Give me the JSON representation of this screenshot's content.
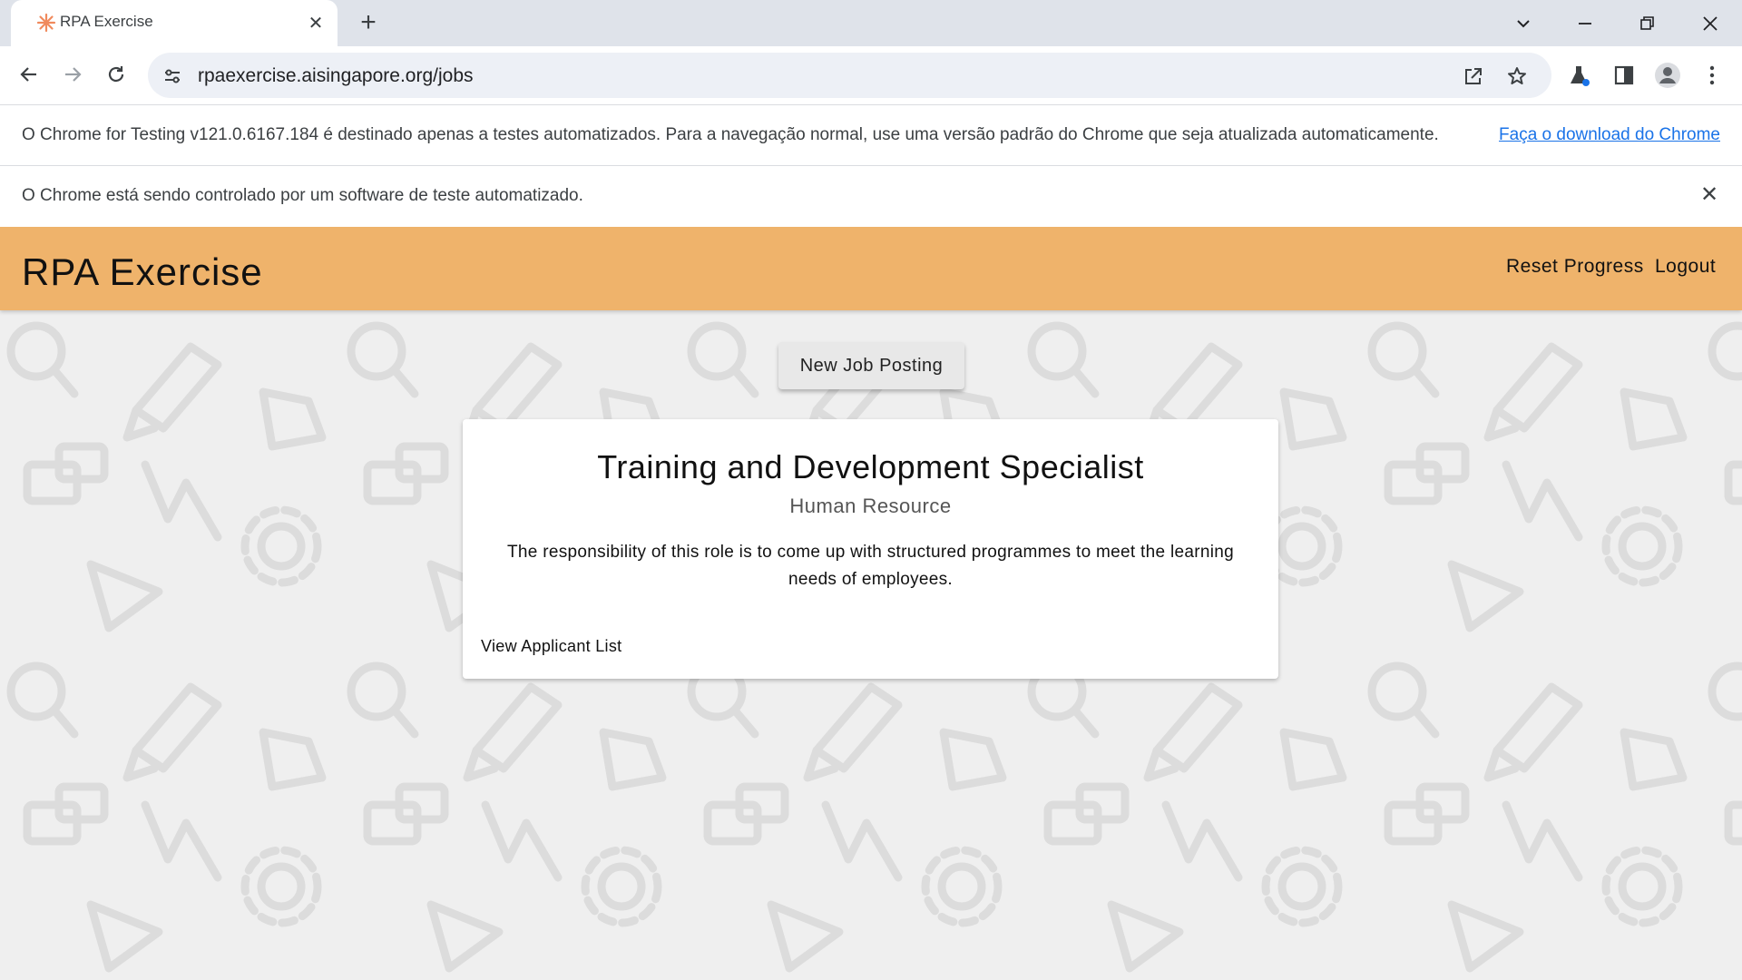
{
  "browser": {
    "tab": {
      "title": "RPA Exercise"
    },
    "url": "rpaexercise.aisingapore.org/jobs",
    "infobar_testing": {
      "text": "O Chrome for Testing v121.0.6167.184 é destinado apenas a testes automatizados. Para a navegação normal, use uma versão padrão do Chrome que seja atualizada automaticamente.",
      "link": "Faça o download do Chrome"
    },
    "infobar_automation": {
      "text": "O Chrome está sendo controlado por um software de teste automatizado."
    }
  },
  "app": {
    "brand": "RPA Exercise",
    "nav": {
      "reset": "Reset Progress",
      "logout": "Logout"
    },
    "new_job_button": "New Job Posting",
    "job": {
      "title": "Training and Development Specialist",
      "department": "Human Resource",
      "description": "The responsibility of this role is to come up with structured programmes to meet the learning needs of employees.",
      "link": "View Applicant List"
    },
    "colors": {
      "header": "#efb36b",
      "background": "#efefef"
    }
  }
}
